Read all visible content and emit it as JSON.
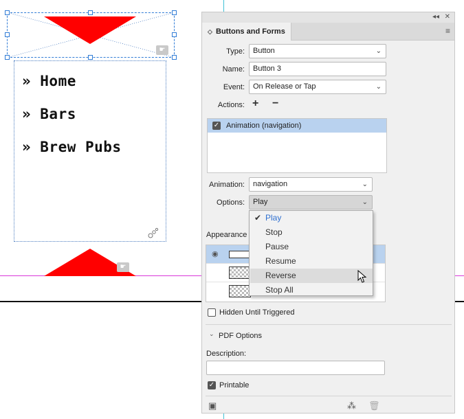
{
  "canvas": {
    "nav_items": [
      "» Home",
      "» Bars",
      "» Brew Pubs"
    ]
  },
  "panel": {
    "tab_title": "Buttons and Forms",
    "type_label": "Type:",
    "type_value": "Button",
    "name_label": "Name:",
    "name_value": "Button 3",
    "event_label": "Event:",
    "event_value": "On Release or Tap",
    "actions_label": "Actions:",
    "add_action": "+",
    "remove_action": "−",
    "action_items": [
      {
        "label": "Animation (navigation)",
        "checked": true
      }
    ],
    "animation_label": "Animation:",
    "animation_value": "navigation",
    "options_label": "Options:",
    "options_value": "Play",
    "appearance_label": "Appearance",
    "hidden_until_triggered_label": "Hidden Until Triggered",
    "hidden_until_triggered_checked": false,
    "pdf_options_label": "PDF Options",
    "description_label": "Description:",
    "description_value": "",
    "printable_label": "Printable",
    "printable_checked": true
  },
  "options_dropdown": {
    "items": [
      "Play",
      "Stop",
      "Pause",
      "Resume",
      "Reverse",
      "Stop All"
    ],
    "checked": "Play",
    "hovered": "Reverse"
  },
  "colors": {
    "accent_blue": "#2f70d0",
    "selection_row": "#b9d2ef",
    "shape_red": "#ff0000"
  }
}
